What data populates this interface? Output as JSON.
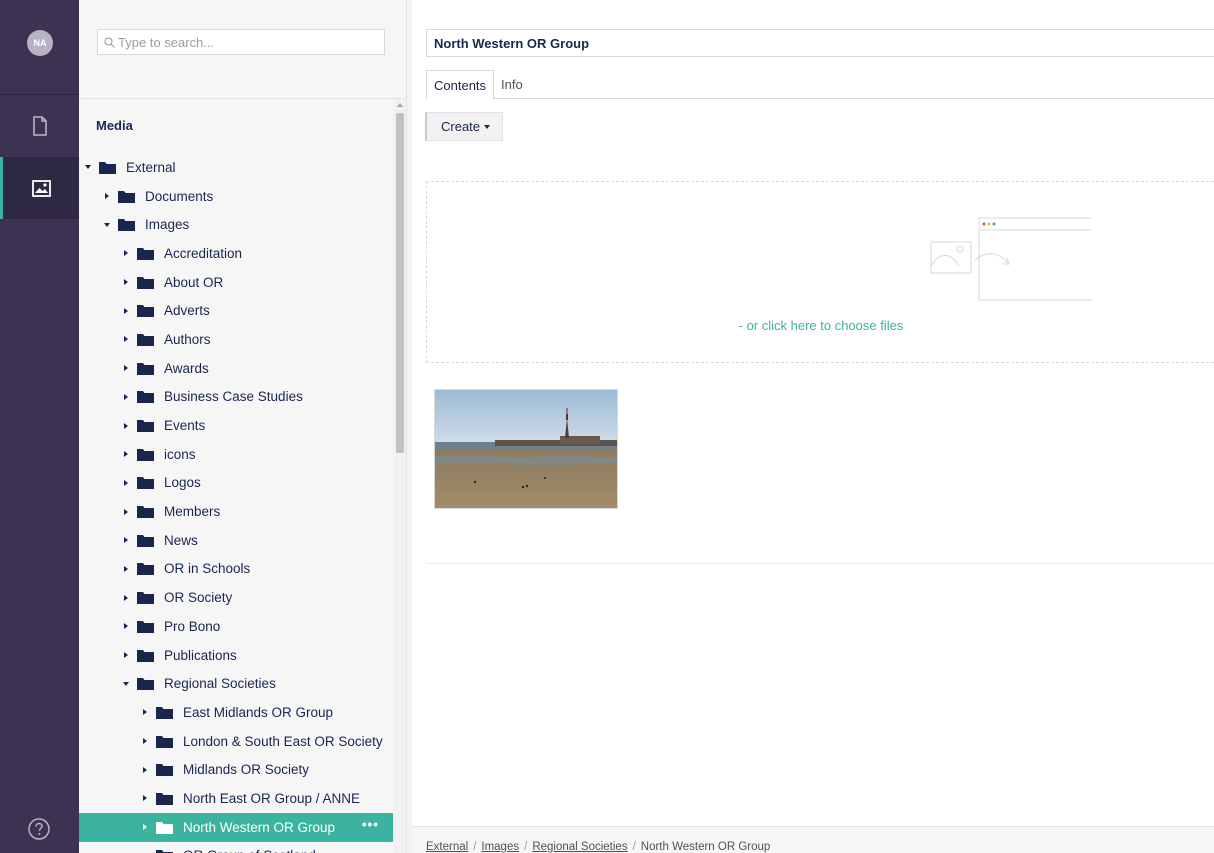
{
  "rail": {
    "avatar_initials": "NA",
    "items": [
      {
        "icon": "document-icon",
        "active": false
      },
      {
        "icon": "image-icon",
        "active": true
      }
    ],
    "help_icon": "help-icon"
  },
  "tree": {
    "search_placeholder": "Type to search...",
    "heading": "Media",
    "items": [
      {
        "label": "External",
        "depth": 0,
        "expanded": true
      },
      {
        "label": "Documents",
        "depth": 1,
        "expanded": false
      },
      {
        "label": "Images",
        "depth": 1,
        "expanded": true
      },
      {
        "label": "Accreditation",
        "depth": 2,
        "expanded": false
      },
      {
        "label": "About OR",
        "depth": 2,
        "expanded": false
      },
      {
        "label": "Adverts",
        "depth": 2,
        "expanded": false
      },
      {
        "label": "Authors",
        "depth": 2,
        "expanded": false
      },
      {
        "label": "Awards",
        "depth": 2,
        "expanded": false
      },
      {
        "label": "Business Case Studies",
        "depth": 2,
        "expanded": false
      },
      {
        "label": "Events",
        "depth": 2,
        "expanded": false
      },
      {
        "label": "icons",
        "depth": 2,
        "expanded": false
      },
      {
        "label": "Logos",
        "depth": 2,
        "expanded": false
      },
      {
        "label": "Members",
        "depth": 2,
        "expanded": false
      },
      {
        "label": "News",
        "depth": 2,
        "expanded": false
      },
      {
        "label": "OR in Schools",
        "depth": 2,
        "expanded": false
      },
      {
        "label": "OR Society",
        "depth": 2,
        "expanded": false
      },
      {
        "label": "Pro Bono",
        "depth": 2,
        "expanded": false
      },
      {
        "label": "Publications",
        "depth": 2,
        "expanded": false
      },
      {
        "label": "Regional Societies",
        "depth": 2,
        "expanded": true
      },
      {
        "label": "East Midlands OR Group",
        "depth": 3,
        "expanded": false
      },
      {
        "label": "London & South East OR Society",
        "depth": 3,
        "expanded": false
      },
      {
        "label": "Midlands OR Society",
        "depth": 3,
        "expanded": false
      },
      {
        "label": "North East OR Group / ANNE",
        "depth": 3,
        "expanded": false
      },
      {
        "label": "North Western OR Group",
        "depth": 3,
        "expanded": false,
        "selected": true
      },
      {
        "label": "OR Group of Scotland",
        "depth": 3,
        "expanded": false
      }
    ],
    "selected_actions": "•••"
  },
  "main": {
    "name": "North Western OR Group",
    "tabs": [
      {
        "label": "Contents",
        "active": true
      },
      {
        "label": "Info",
        "active": false
      }
    ],
    "create_label": "Create",
    "dropzone_text": "- or click here to choose files",
    "media_items": [
      {
        "type": "image",
        "icon": "beach-tower-photo"
      }
    ]
  },
  "breadcrumb": [
    "External",
    "Images",
    "Regional Societies",
    "North Western OR Group"
  ],
  "colors": {
    "rail_bg": "#3c3353",
    "accent": "#3bb39e",
    "text": "#1b264f",
    "tree_bg": "#f6f6f7"
  }
}
